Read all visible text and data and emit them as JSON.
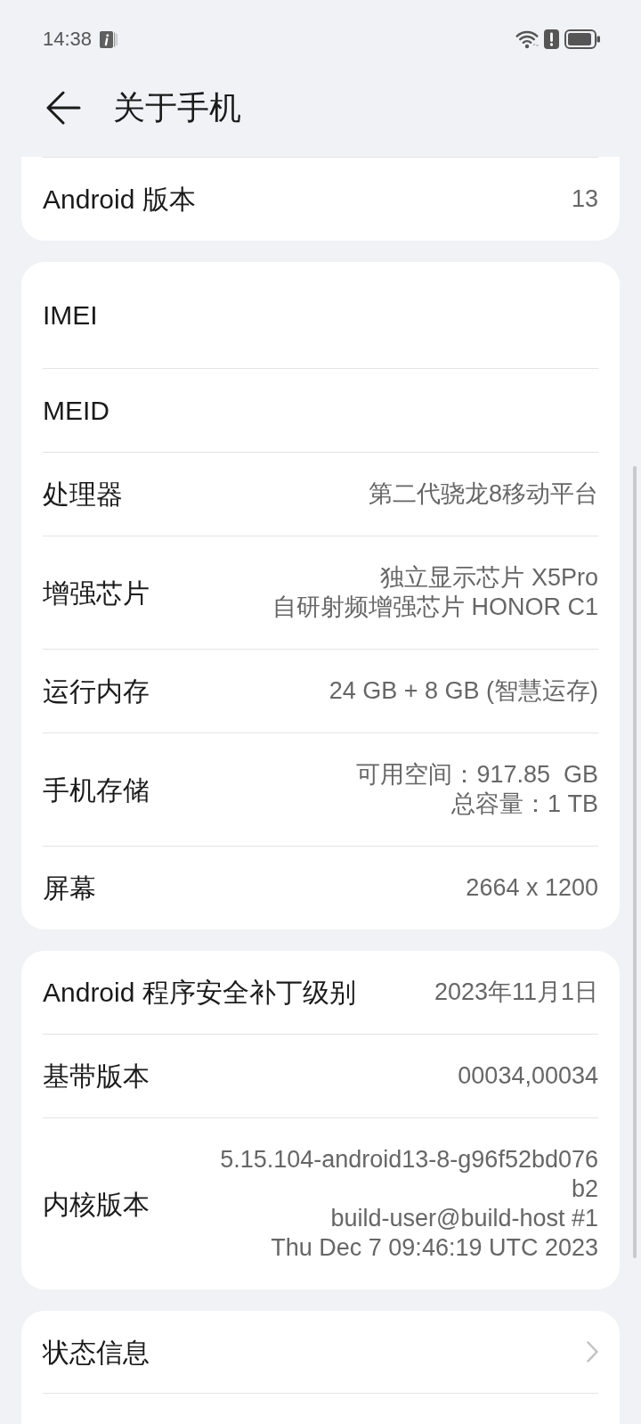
{
  "status_bar": {
    "time": "14:38"
  },
  "header": {
    "title": "关于手机"
  },
  "sections": [
    {
      "rows": [
        {
          "kind": "info",
          "label": "Android 版本",
          "value": [
            "13"
          ]
        }
      ]
    },
    {
      "rows": [
        {
          "kind": "info",
          "label": "IMEI"
        },
        {
          "kind": "info",
          "label": "MEID"
        },
        {
          "kind": "info",
          "label": "处理器",
          "value": [
            "第二代骁龙8移动平台"
          ]
        },
        {
          "kind": "info",
          "label": "增强芯片",
          "value": [
            "独立显示芯片 X5Pro",
            "自研射频增强芯片 HONOR C1"
          ]
        },
        {
          "kind": "info",
          "label": "运行内存",
          "value": [
            "24 GB + 8 GB (智慧运存)"
          ]
        },
        {
          "kind": "info",
          "label": "手机存储",
          "value": [
            "可用空间：917.85  GB",
            "总容量：1 TB"
          ]
        },
        {
          "kind": "info",
          "label": "屏幕",
          "value": [
            "2664 x 1200"
          ]
        }
      ]
    },
    {
      "rows": [
        {
          "kind": "info",
          "label": "Android 程序安全补丁级别",
          "value": [
            "2023年11月1日"
          ]
        },
        {
          "kind": "info",
          "label": "基带版本",
          "value": [
            "00034,00034"
          ]
        },
        {
          "kind": "info",
          "label": "内核版本",
          "value": [
            "5.15.104-android13-8-g96f52bd076",
            "b2",
            "build-user@build-host #1",
            "Thu Dec 7 09:46:19 UTC 2023"
          ]
        }
      ]
    },
    {
      "rows": [
        {
          "kind": "link",
          "label": "状态信息"
        },
        {
          "kind": "link"
        }
      ]
    }
  ]
}
